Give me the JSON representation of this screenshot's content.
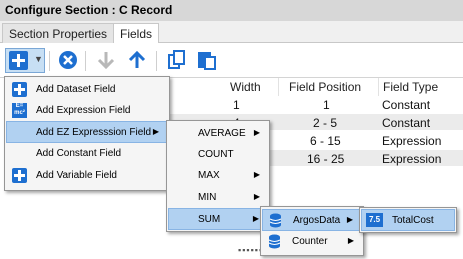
{
  "window": {
    "title": "Configure Section : C Record"
  },
  "tabs": [
    {
      "label": "Section Properties"
    },
    {
      "label": "Fields"
    }
  ],
  "toolbar": {
    "add_icon": "plus-icon",
    "delete_icon": "delete-icon",
    "move_down_icon": "arrow-down-icon",
    "move_up_icon": "arrow-up-icon",
    "copy_icon": "copy-icon",
    "paste_icon": "paste-icon"
  },
  "grid": {
    "columns": [
      "Width",
      "Field Position",
      "Field Type"
    ],
    "rows": [
      [
        "1",
        "1",
        "Constant"
      ],
      [
        "4",
        "2 - 5",
        "Constant"
      ],
      [
        "",
        "6 - 15",
        "Expression"
      ],
      [
        "",
        "16 - 25",
        "Expression"
      ]
    ]
  },
  "menu_main": {
    "items": [
      {
        "label": "Add Dataset Field",
        "underline": "D"
      },
      {
        "label": "Add Expression Field",
        "underline": "E"
      },
      {
        "label": "Add EZ Expresssion Field",
        "underline": "Z"
      },
      {
        "label": "Add Constant Field",
        "underline": "C"
      },
      {
        "label": "Add Variable Field",
        "underline": "V"
      }
    ]
  },
  "menu_ez": {
    "items": [
      {
        "label": "AVERAGE"
      },
      {
        "label": "COUNT"
      },
      {
        "label": "MAX"
      },
      {
        "label": "MIN"
      },
      {
        "label": "SUM"
      }
    ]
  },
  "menu_sum": {
    "items": [
      {
        "label": "ArgosData"
      },
      {
        "label": "Counter"
      }
    ]
  },
  "menu_argos": {
    "items": [
      {
        "label": "TotalCost",
        "badge": "7.5"
      }
    ]
  },
  "colors": {
    "highlight": "#b1d1f1",
    "accent": "#1e6fd0"
  }
}
